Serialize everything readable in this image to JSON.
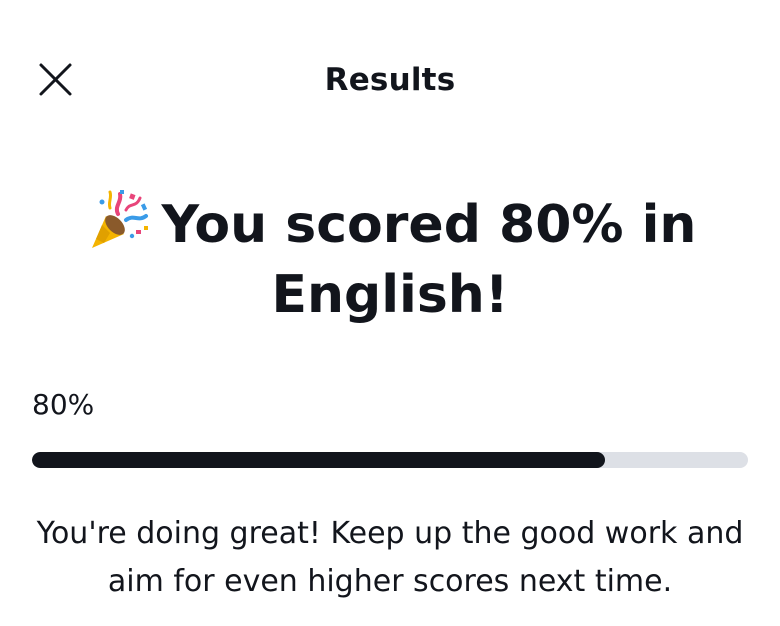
{
  "header": {
    "title": "Results",
    "close_icon": "close-icon"
  },
  "result": {
    "icon": "party-popper-icon",
    "headline": "You scored 80% in English!",
    "score_label": "80%",
    "progress": 0.8,
    "message": "You're doing great! Keep up the good work and aim for even higher scores next time."
  },
  "colors": {
    "text": "#12151c",
    "progress_fill": "#12151c",
    "progress_track": "#dde0e6",
    "background": "#ffffff"
  }
}
